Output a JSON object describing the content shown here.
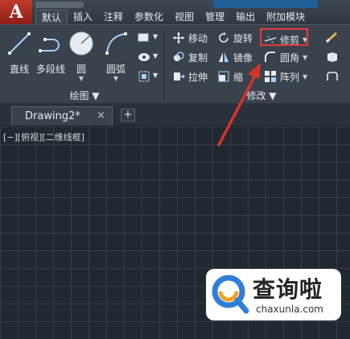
{
  "app": {
    "logo_letter": "A"
  },
  "ribbon_tabs": [
    "默认",
    "插入",
    "注释",
    "参数化",
    "视图",
    "管理",
    "输出",
    "附加模块"
  ],
  "draw_panel": {
    "tools": [
      {
        "label": "直线",
        "icon": "line-icon"
      },
      {
        "label": "多段线",
        "icon": "polyline-icon"
      },
      {
        "label": "圆",
        "icon": "circle-icon"
      },
      {
        "label": "圆弧",
        "icon": "arc-icon"
      }
    ],
    "title": "绘图"
  },
  "modify_panel": {
    "rows": [
      [
        "移动",
        "旋转",
        "修剪"
      ],
      [
        "复制",
        "镜像",
        "圆角"
      ],
      [
        "拉伸",
        "缩",
        "阵列"
      ]
    ],
    "title": "修改"
  },
  "file_tab": {
    "label": "Drawing2*",
    "close": "×",
    "new": "+"
  },
  "viewport": {
    "label": "[−][俯视][二维线框]"
  },
  "watermark": {
    "title": "查询啦",
    "url": "chaxunla.com"
  },
  "colors": {
    "highlight": "#e23b3b",
    "canvas": "#212830",
    "ribbon": "#3a424c",
    "app_red": "#c0392b"
  }
}
